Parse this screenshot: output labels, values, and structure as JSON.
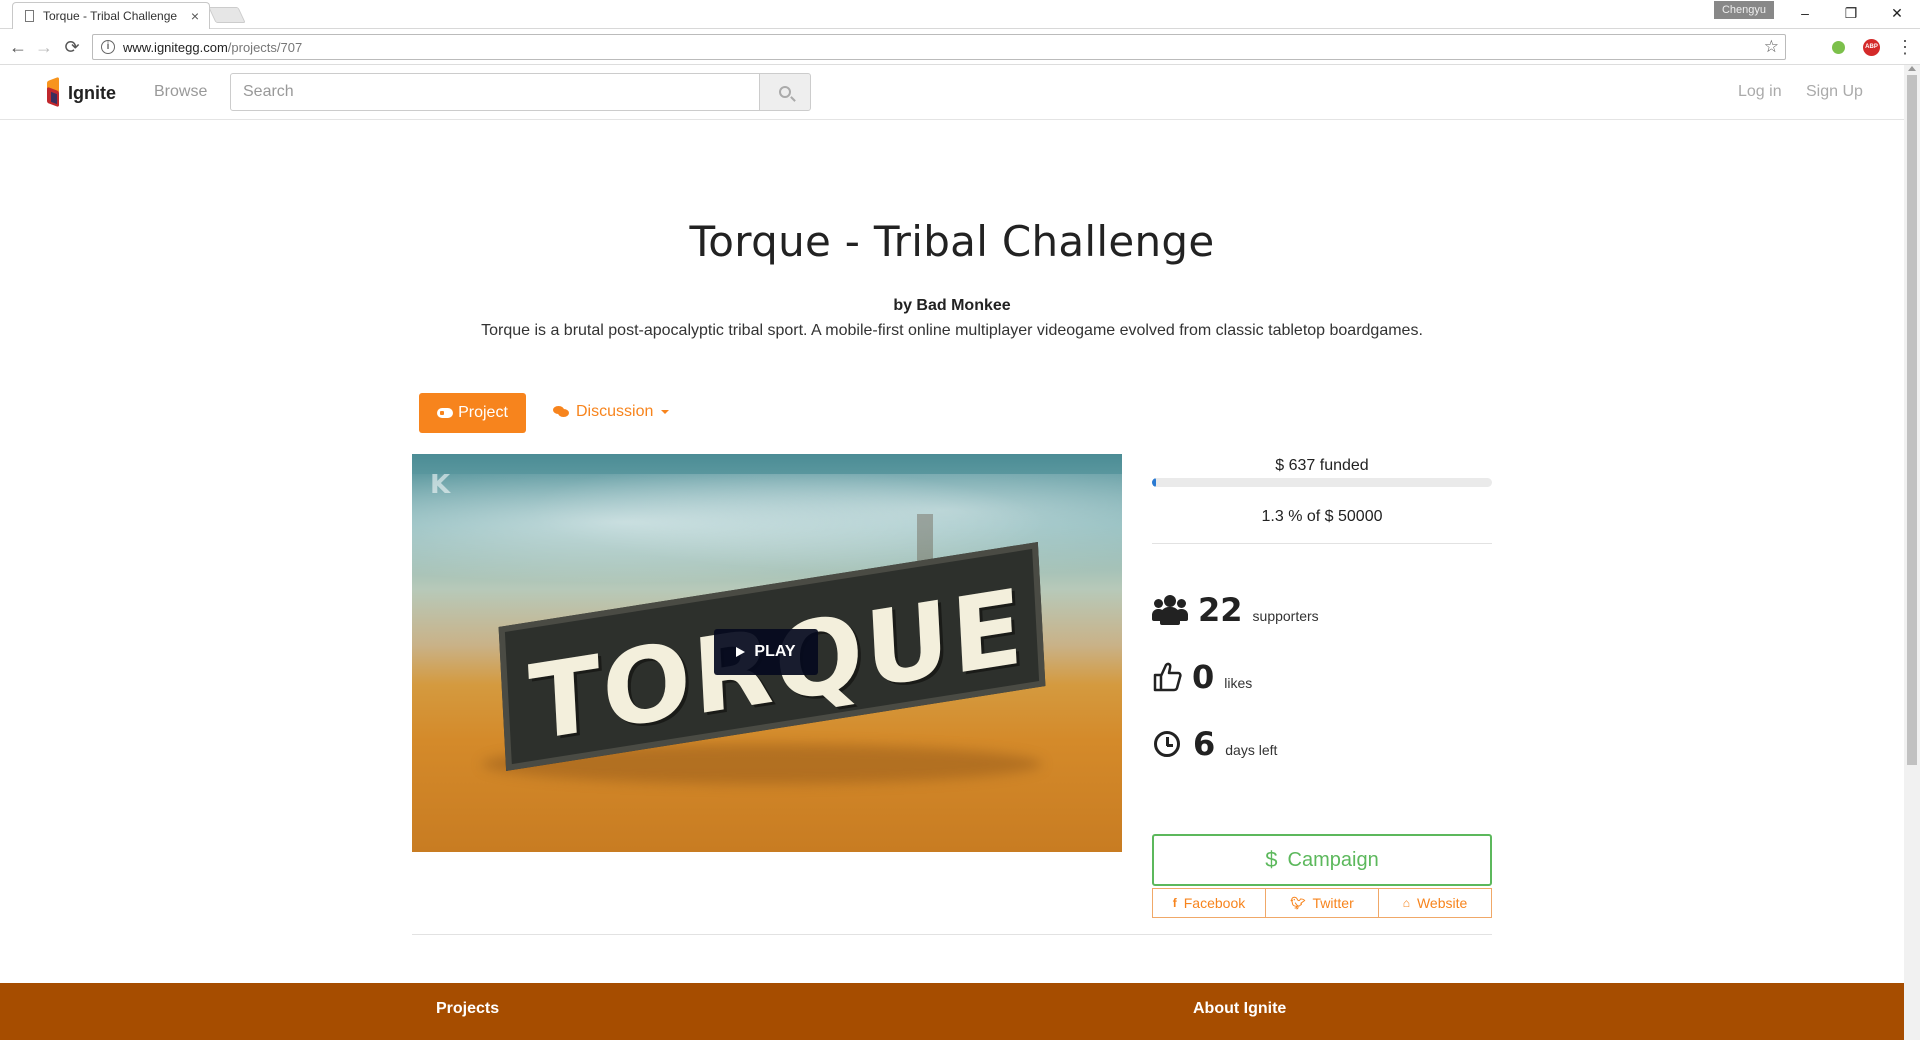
{
  "browser": {
    "tab_title": "Torque - Tribal Challenge",
    "tab_close": "×",
    "profile_name": "Chengyu",
    "url_host": "www.ignitegg.com",
    "url_path": "/projects/707",
    "win_minimize": "–",
    "win_restore": "❐",
    "win_close": "✕",
    "back": "←",
    "forward": "→",
    "reload": "⟳",
    "star": "☆",
    "menu": "⋮",
    "ext_abp": "ABP"
  },
  "site": {
    "brand": "Ignite",
    "nav_browse": "Browse",
    "search_placeholder": "Search",
    "nav_login": "Log in",
    "nav_signup": "Sign Up"
  },
  "project": {
    "title": "Torque - Tribal Challenge",
    "author": "by Bad Monkee",
    "description": "Torque is a brutal post-apocalyptic tribal sport. A mobile-first online multiplayer videogame evolved from classic tabletop boardgames.",
    "tabs": {
      "project": "Project",
      "discussion": "Discussion"
    },
    "video": {
      "play_label": "PLAY",
      "logo_text": "TORQUE",
      "provider_mark": "K"
    },
    "funding": {
      "funded_text": "$ 637 funded",
      "percent_text": "1.3 % of $ 50000",
      "progress_fraction": 0.013
    },
    "stats": {
      "supporters_value": "22",
      "supporters_label": "supporters",
      "likes_value": "0",
      "likes_label": "likes",
      "days_value": "6",
      "days_label": "days left"
    },
    "campaign_label": "Campaign",
    "campaign_icon": "$",
    "share": {
      "facebook": "Facebook",
      "twitter": "Twitter",
      "website": "Website"
    }
  },
  "footer": {
    "col1_title": "Projects",
    "col2_title": "About Ignite",
    "color": "#a64d00"
  },
  "colors": {
    "accent": "#f7841d",
    "campaign": "#5cb85c",
    "progress": "#2a7ad2"
  }
}
